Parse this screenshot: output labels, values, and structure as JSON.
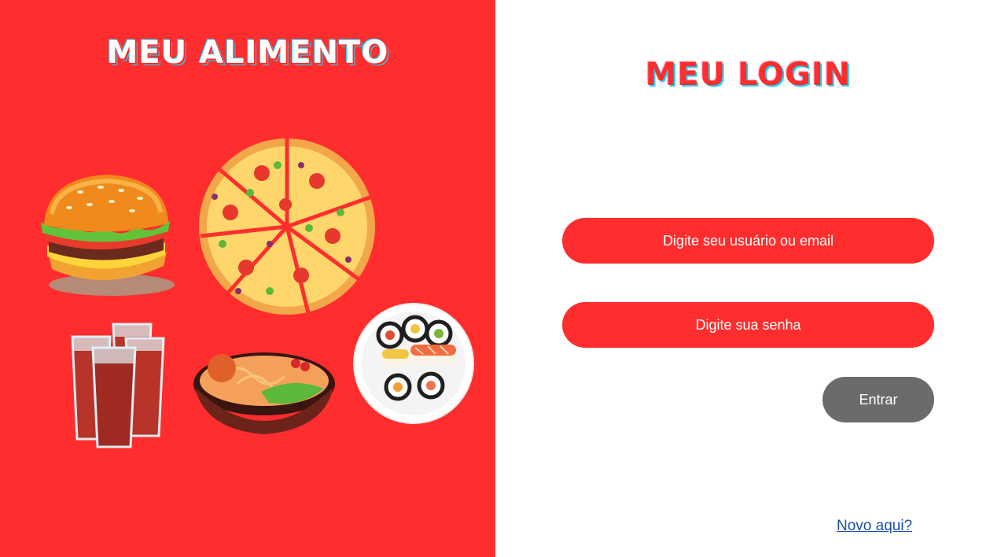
{
  "left_panel": {
    "brand_title": "MEU ALIMENTO",
    "background_color": "#ff2d2d",
    "illustrations": [
      "burger-illustration",
      "pizza-illustration",
      "soda-glasses-illustration",
      "noodle-bowl-illustration",
      "sushi-plate-illustration"
    ]
  },
  "login": {
    "title": "MEU LOGIN",
    "username_placeholder": "Digite seu usuário ou email",
    "username_value": "",
    "password_placeholder": "Digite sua senha",
    "password_value": "",
    "submit_label": "Entrar",
    "signup_link": "Novo aqui?"
  },
  "colors": {
    "accent": "#ff2d2d",
    "button": "#6b6b6b",
    "link": "#1a4fa8",
    "title_shadow": "#17d6ff"
  }
}
